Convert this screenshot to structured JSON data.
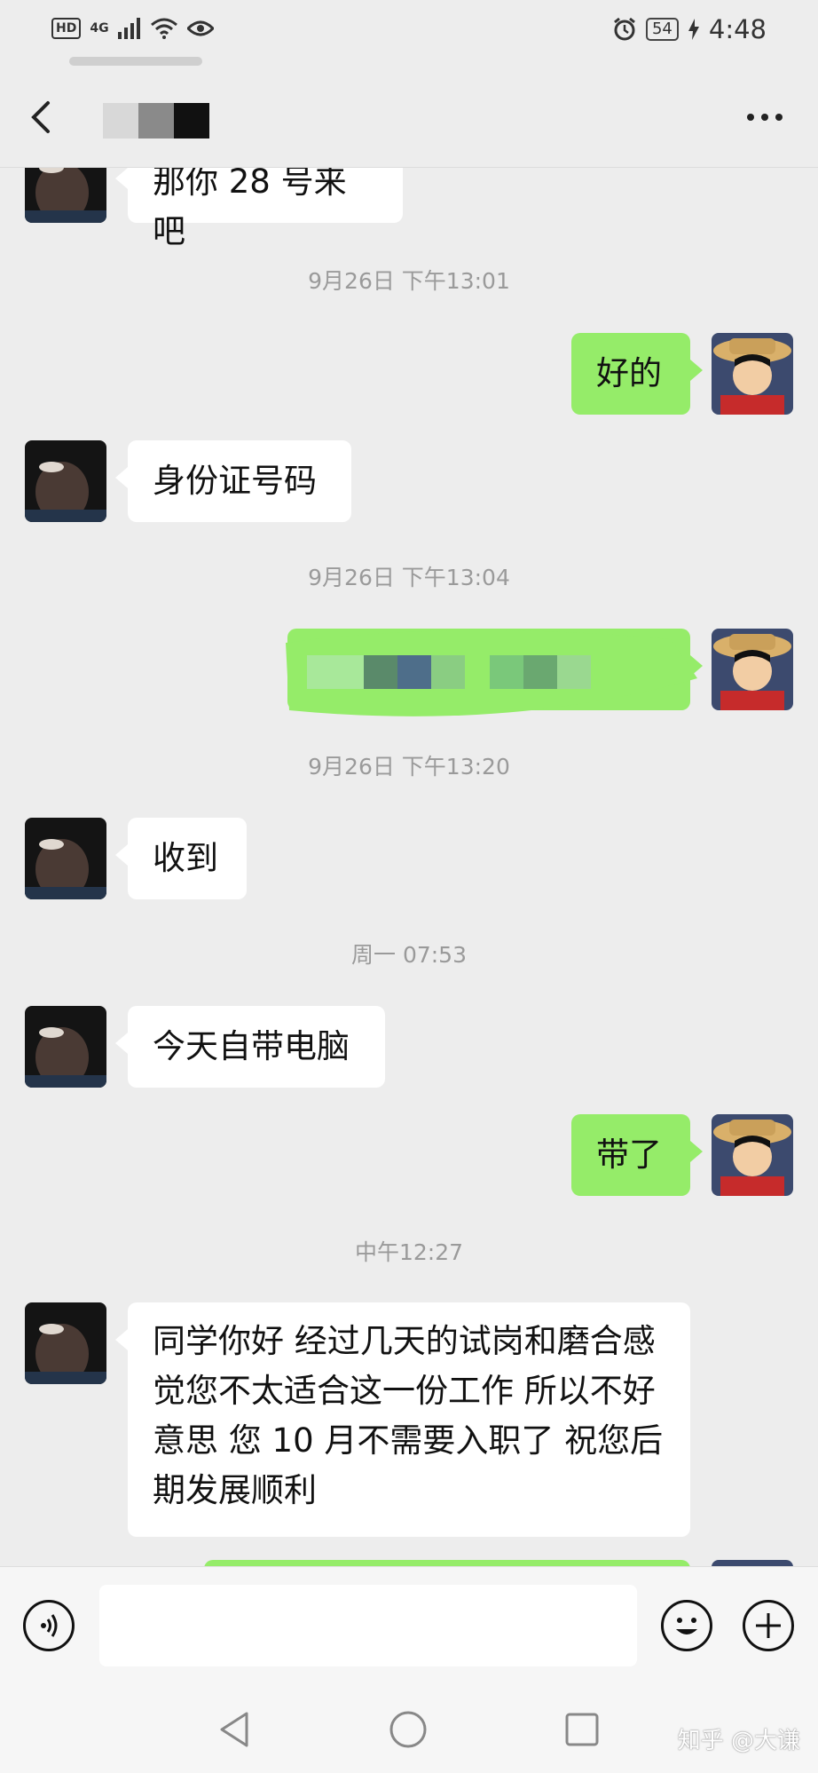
{
  "status_bar": {
    "hd": "HD",
    "network": "4G",
    "battery": "54",
    "time": "4:48"
  },
  "header": {
    "title": "",
    "icons": [
      "back-arrow-icon",
      "more-icon"
    ]
  },
  "messages": [
    {
      "type": "incoming",
      "text": "那你 28 号来吧"
    },
    {
      "type": "timestamp",
      "text": "9月26日 下午13:01"
    },
    {
      "type": "outgoing",
      "text": "好的"
    },
    {
      "type": "incoming",
      "text": "身份证号码"
    },
    {
      "type": "timestamp",
      "text": "9月26日 下午13:04"
    },
    {
      "type": "outgoing-redacted",
      "text": ""
    },
    {
      "type": "timestamp",
      "text": "9月26日 下午13:20"
    },
    {
      "type": "incoming",
      "text": "收到"
    },
    {
      "type": "timestamp",
      "text": "周一 07:53"
    },
    {
      "type": "incoming",
      "text": "今天自带电脑"
    },
    {
      "type": "outgoing",
      "text": "带了"
    },
    {
      "type": "timestamp",
      "text": "中午12:27"
    },
    {
      "type": "incoming",
      "text": "同学你好 经过几天的试岗和磨合感觉您不太适合这一份工作 所以不好意思 您 10 月不需要入职了 祝您后期发展顺利"
    }
  ],
  "input_bar": {
    "text_value": "",
    "icons": [
      "voice-icon",
      "emoji-icon",
      "plus-icon"
    ]
  },
  "nav_bar": {
    "icons": [
      "nav-back-icon",
      "nav-home-icon",
      "nav-recent-icon"
    ],
    "watermark": "知乎 @大谦"
  },
  "colors": {
    "background": "#ededed",
    "outgoing_bubble": "#95ec69",
    "incoming_bubble": "#ffffff",
    "timestamp_text": "#9a9a9a"
  }
}
